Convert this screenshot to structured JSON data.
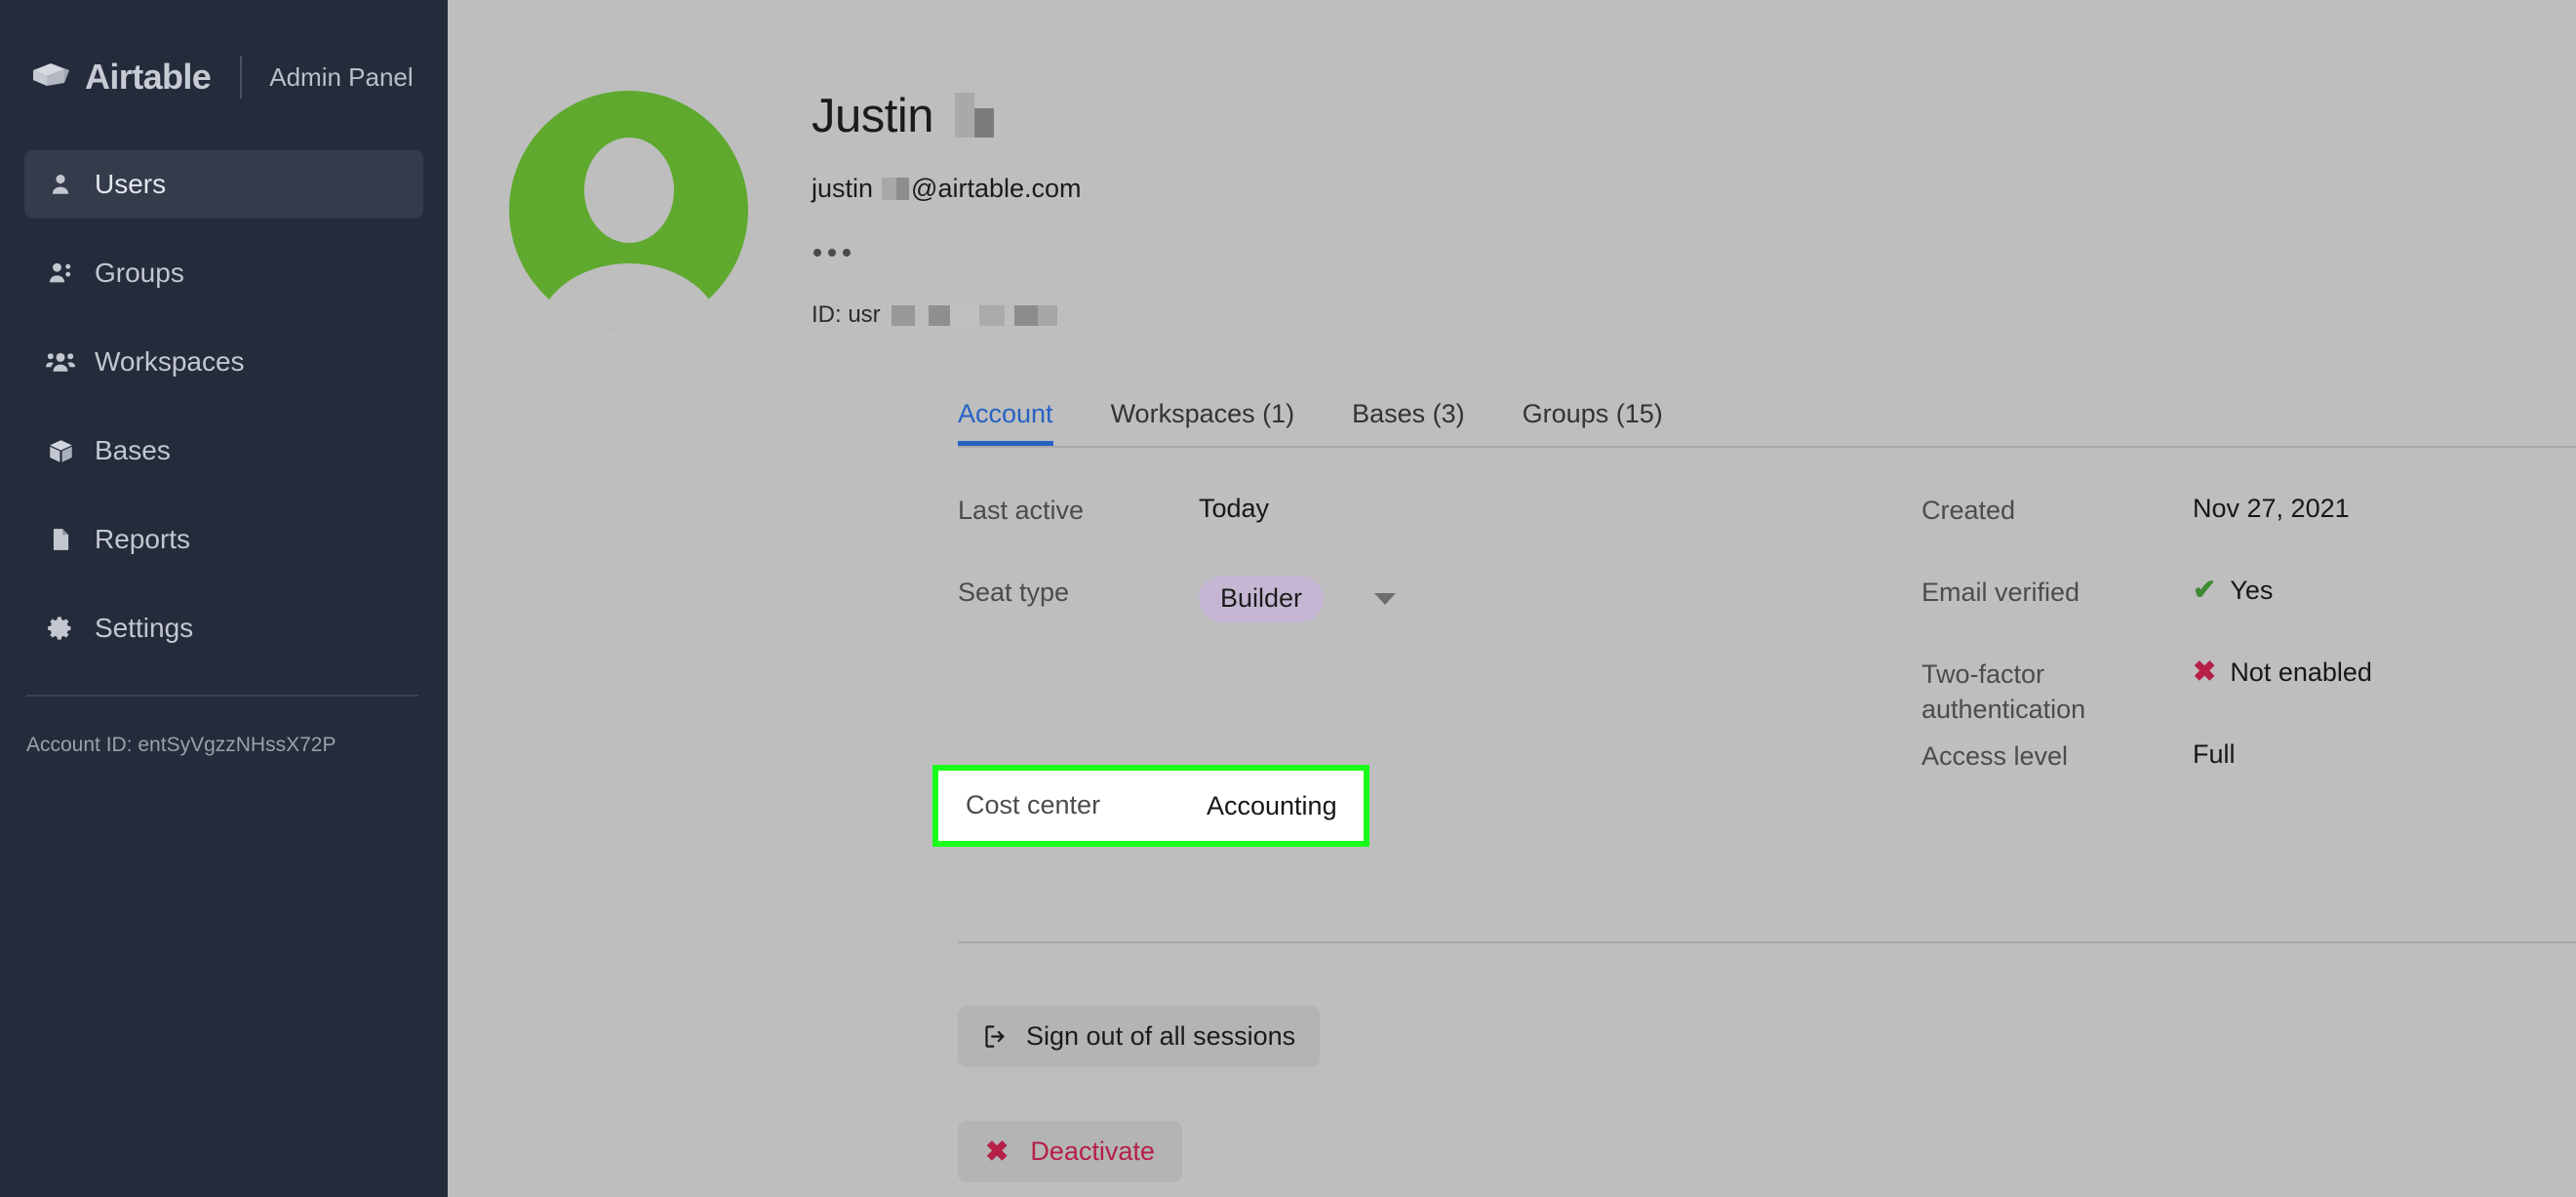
{
  "sidebar": {
    "brand_name": "Airtable",
    "brand_sub": "Admin Panel",
    "items": [
      {
        "label": "Users",
        "icon": "user-icon",
        "active": true
      },
      {
        "label": "Groups",
        "icon": "users-icon",
        "active": false
      },
      {
        "label": "Workspaces",
        "icon": "user-group-icon",
        "active": false
      },
      {
        "label": "Bases",
        "icon": "cube-icon",
        "active": false
      },
      {
        "label": "Reports",
        "icon": "document-icon",
        "active": false
      },
      {
        "label": "Settings",
        "icon": "gear-icon",
        "active": false
      }
    ],
    "account_id": "Account ID: entSyVgzzNHssX72P"
  },
  "profile": {
    "name": "Justin",
    "email_prefix": "justin",
    "email_suffix": "@airtable.com",
    "id_prefix": "ID: usr",
    "overflow_menu": "…",
    "avatar_icon": "person-avatar-icon",
    "avatar_color": "#5fa92f"
  },
  "tabs": [
    {
      "label": "Account",
      "active": true
    },
    {
      "label": "Workspaces (1)",
      "active": false
    },
    {
      "label": "Bases (3)",
      "active": false
    },
    {
      "label": "Groups (15)",
      "active": false
    }
  ],
  "details": {
    "left": [
      {
        "label": "Last active",
        "value": "Today",
        "type": "text"
      },
      {
        "label": "Seat type",
        "value": "Builder",
        "type": "pill"
      }
    ],
    "highlight_row": {
      "label": "Cost center",
      "value": "Accounting",
      "border_color": "#1aff1a"
    },
    "right": [
      {
        "label": "Created",
        "value": "Nov 27, 2021",
        "icon": ""
      },
      {
        "label": "Email verified",
        "value": "Yes",
        "icon": "check-icon"
      },
      {
        "label": "Two-factor authentication",
        "value": "Not enabled",
        "icon": "x-icon"
      },
      {
        "label": "Access level",
        "value": "Full",
        "icon": ""
      }
    ]
  },
  "actions": {
    "signout_label": "Sign out of all sessions",
    "signout_icon": "logout-icon",
    "deactivate_label": "Deactivate",
    "deactivate_icon": "x-icon",
    "deactivate_color": "#b51f48"
  },
  "colors": {
    "accent": "#2662c4",
    "sidebar_bg": "#242b3a",
    "page_bg": "#bebebe",
    "pill_bg": "#c5b7d3",
    "success": "#3f8a34",
    "danger": "#b51f48"
  }
}
